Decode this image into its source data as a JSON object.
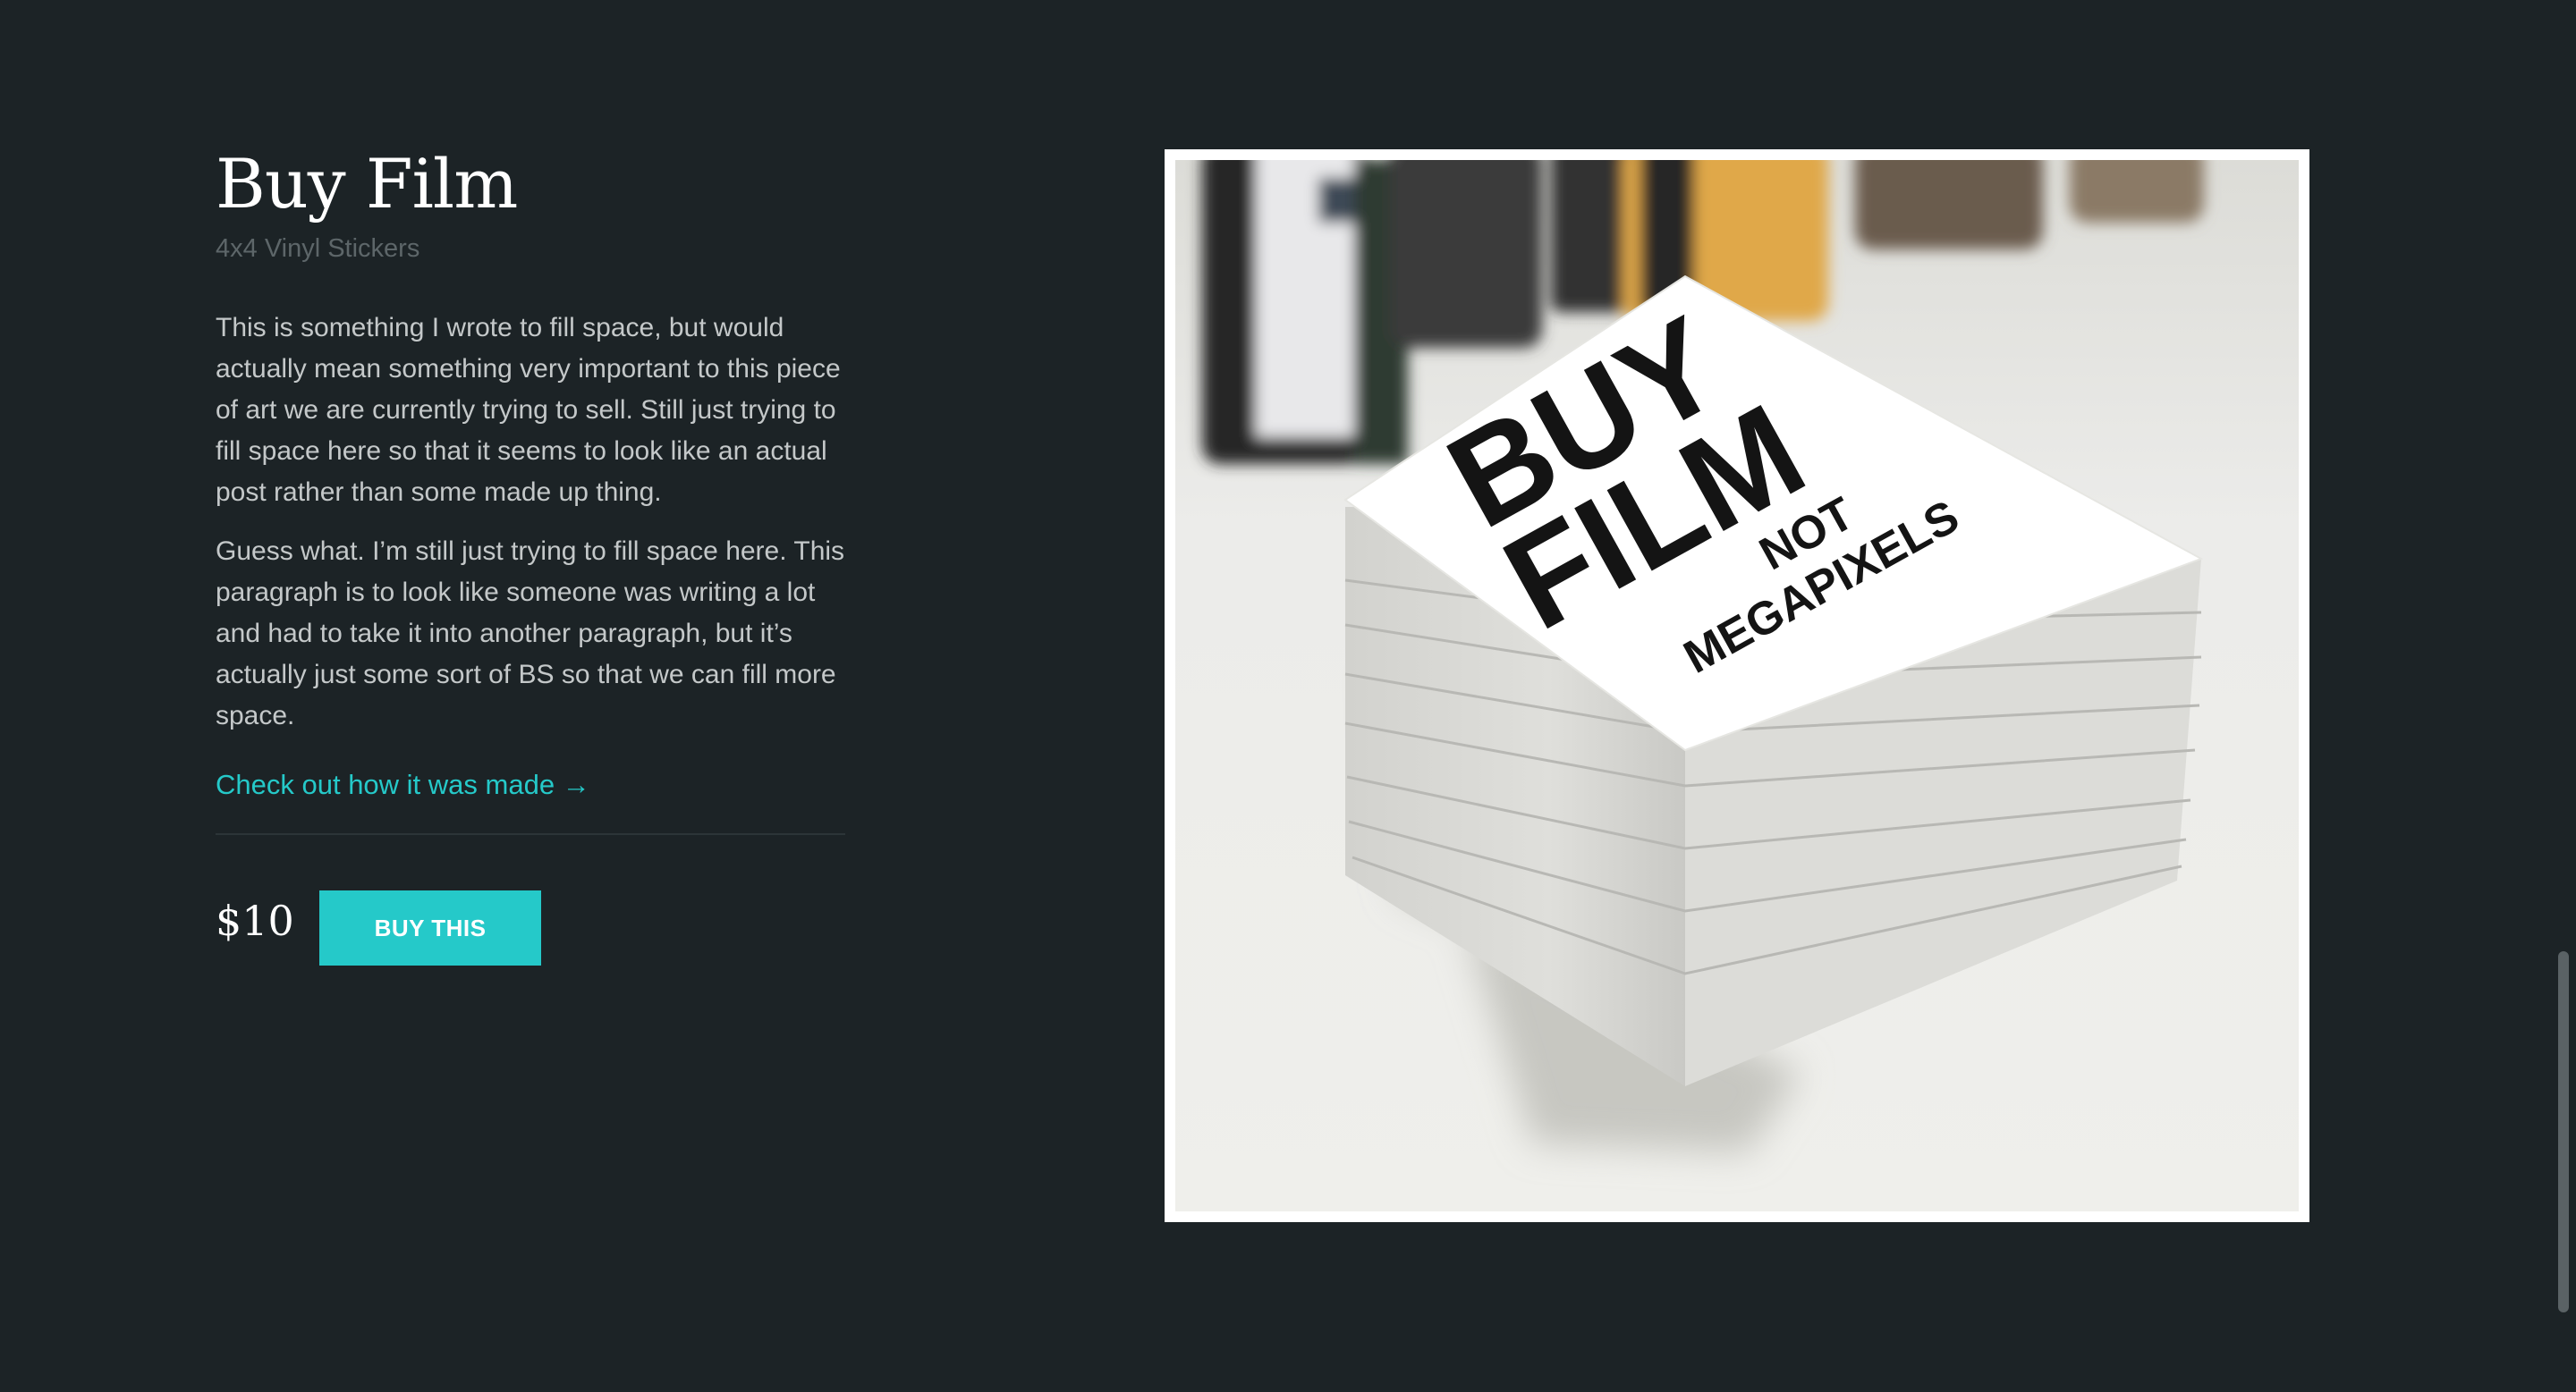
{
  "product": {
    "title": "Buy Film",
    "subtitle": "4x4 Vinyl Stickers",
    "paragraphs": [
      "This is something I wrote to fill space, but would actually mean something very important to this piece of art we are currently trying to sell. Still just trying to fill space here so that it seems to look like an actual post rather than some made up thing.",
      "Guess what. I’m still just trying to fill space here. This paragraph is to look like someone was writing a lot and had to take it into another paragraph, but it’s actually just some sort of BS so that we can fill more space."
    ],
    "link_text": "Check out how it was made →",
    "price": "$10",
    "buy_label": "BUY THIS"
  },
  "image": {
    "sticker_line1": "BUY",
    "sticker_line2": "FILM",
    "sticker_line3": "NOT",
    "sticker_line4": "MEGAPIXELS"
  },
  "colors": {
    "background": "#1c2326",
    "accent": "#25c9c9",
    "heading": "#ffffff",
    "body_text": "#c4c8c9",
    "muted_text": "#5d6669"
  }
}
